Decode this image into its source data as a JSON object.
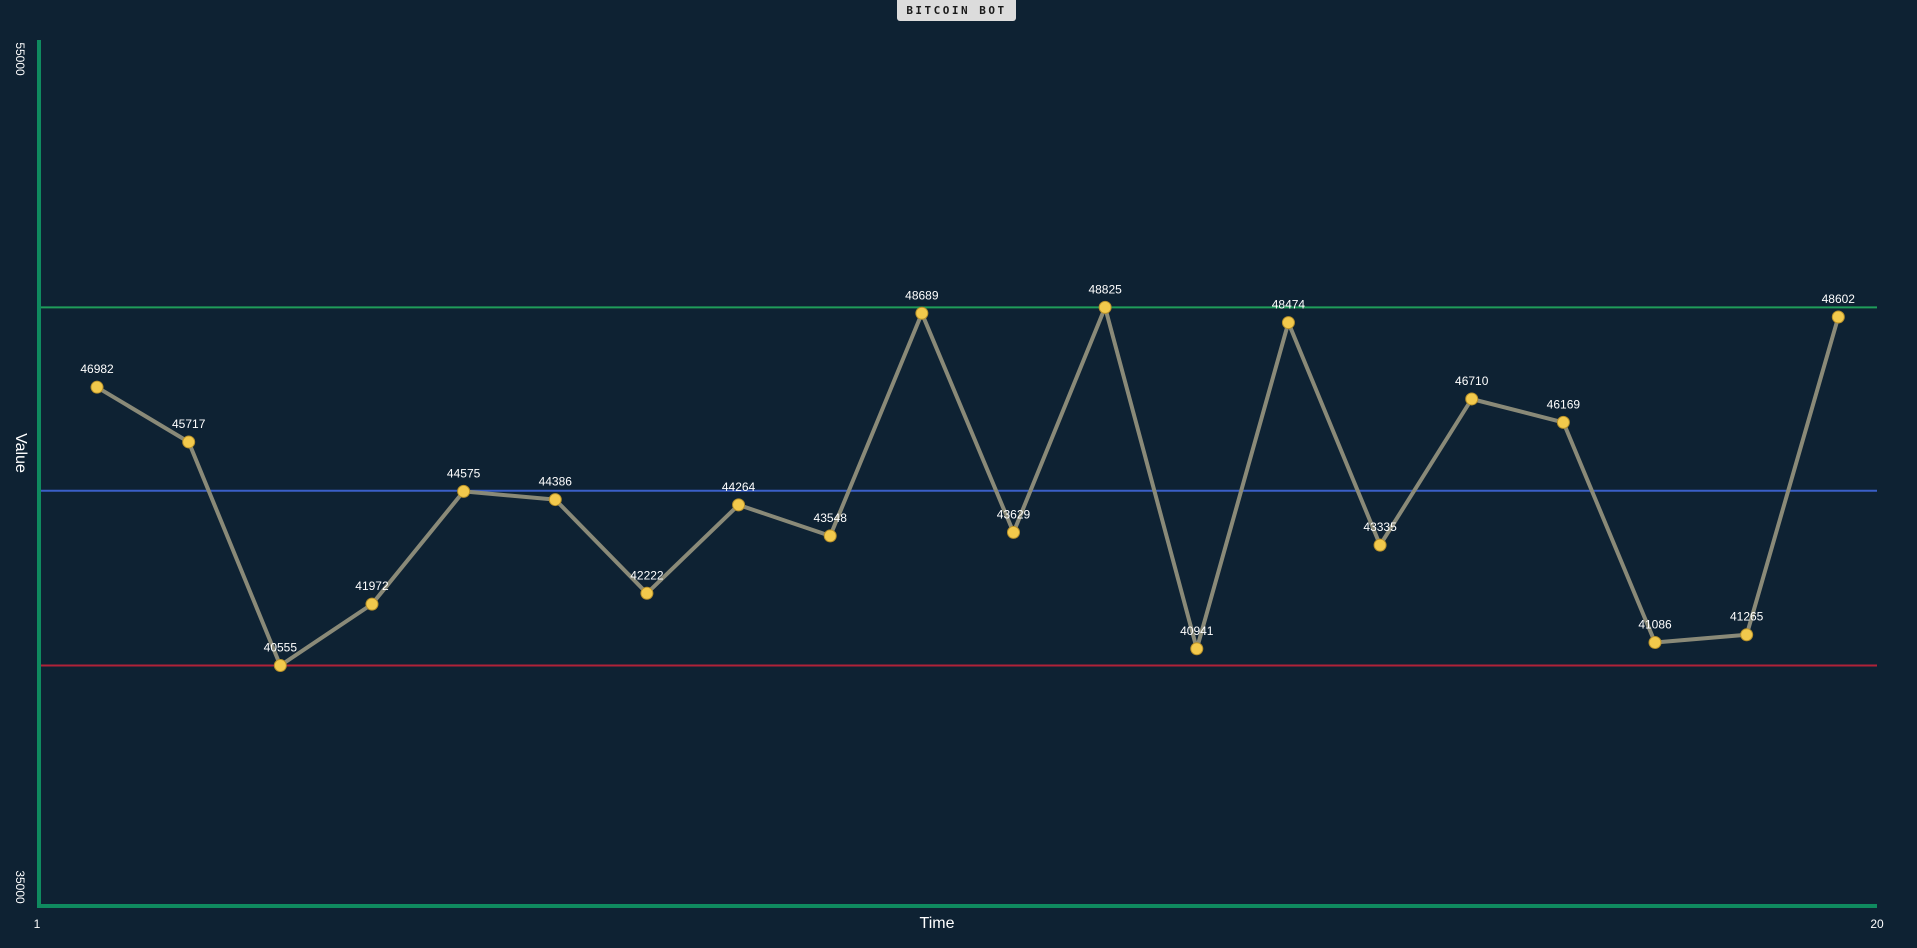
{
  "title_button": {
    "label": "BITCOIN BOT"
  },
  "colors": {
    "background": "#0e2233",
    "axis": "#0f8a5f",
    "line": "#8a8a78",
    "point": "#f2c94c",
    "upper_line": "#1f9d5a",
    "mid_line": "#3a5fc8",
    "lower_line": "#b02238",
    "button_bg": "#dcdcdc"
  },
  "chart_data": {
    "type": "line",
    "title": "",
    "xlabel": "Time",
    "ylabel": "Value",
    "xlim": [
      1,
      20
    ],
    "ylim": [
      35000,
      55000
    ],
    "x_tick_labels": [
      "1",
      "20"
    ],
    "y_tick_labels": [
      "35000",
      "55000"
    ],
    "grid": false,
    "legend": "none",
    "x": [
      1.6,
      2.6,
      3.6,
      4.6,
      5.6,
      6.6,
      7.6,
      8.6,
      9.6,
      10.6,
      11.6,
      12.6,
      13.6,
      14.6,
      15.6,
      16.6,
      17.6,
      18.6,
      19.6
    ],
    "values": [
      46982,
      45717,
      40555,
      41972,
      44575,
      44386,
      42222,
      44264,
      43548,
      48689,
      43629,
      48825,
      40941,
      48474,
      43335,
      46710,
      46169,
      41086,
      41265,
      48602
    ],
    "reference_lines": [
      {
        "value": 48825
      },
      {
        "value": 44590
      },
      {
        "value": 40555
      }
    ]
  }
}
